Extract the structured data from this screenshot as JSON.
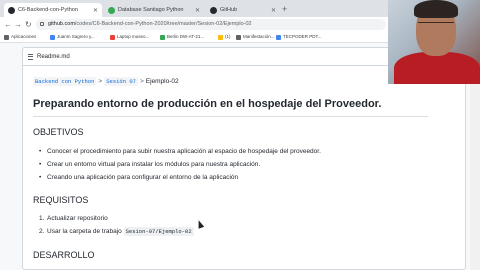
{
  "browser": {
    "tabs": [
      {
        "label": "C6-Backend-con-Python",
        "favicon_color": "#24292f",
        "active": true
      },
      {
        "label": "Database Santiago Python",
        "favicon_color": "#34a853",
        "active": false
      },
      {
        "label": "GitHub",
        "favicon_color": "#24292f",
        "active": false
      }
    ],
    "new_tab_glyph": "+",
    "nav": {
      "back": "←",
      "forward": "→",
      "reload": "↻"
    },
    "address": {
      "host": "github.com",
      "path": "/codes/C6-Backend-con-Python-2020/tree/master/Sesion-02/Ejemplo-02"
    },
    "bookmarks": [
      {
        "label": "Aplicaciones",
        "color": "#5f6368"
      },
      {
        "label": "Juanm Sagrero y...",
        "color": "#4285f4"
      },
      {
        "label": "Laptop museo...",
        "color": "#ea4335"
      },
      {
        "label": "Berlin DW-AT-21...",
        "color": "#34a853"
      },
      {
        "label": "(1)",
        "color": "#fbbc04"
      },
      {
        "label": "Manifestación...",
        "color": "#5f6368"
      },
      {
        "label": "TECPODER PDT...",
        "color": "#4285f4"
      }
    ]
  },
  "readme": {
    "header_label": "Readme.md",
    "breadcrumb": {
      "items": [
        "Backend con Python",
        "Sesión 07"
      ],
      "separator": ">",
      "current": "Ejemplo-02"
    },
    "title": "Preparando entorno de producción en el hospedaje del Proveedor.",
    "sections": {
      "objetivos": {
        "heading": "OBJETIVOS",
        "items": [
          "Conocer el procedimiento para subir nuestra aplicación al espacio de hospedaje del proveedor.",
          "Crear un entorno virtual para instalar los módulos para nuestra aplicación.",
          "Creando una aplicación para configurar el entorno de la aplicación"
        ]
      },
      "requisitos": {
        "heading": "REQUISITOS",
        "items": [
          {
            "num": "1.",
            "text": "Actualizar repositorio"
          },
          {
            "num": "2.",
            "text": "Usar la carpeta de trabajo",
            "code": "Sesion-07/Ejemplo-02"
          }
        ]
      },
      "desarrollo": {
        "heading": "DESARROLLO"
      }
    },
    "bullet": "•"
  }
}
